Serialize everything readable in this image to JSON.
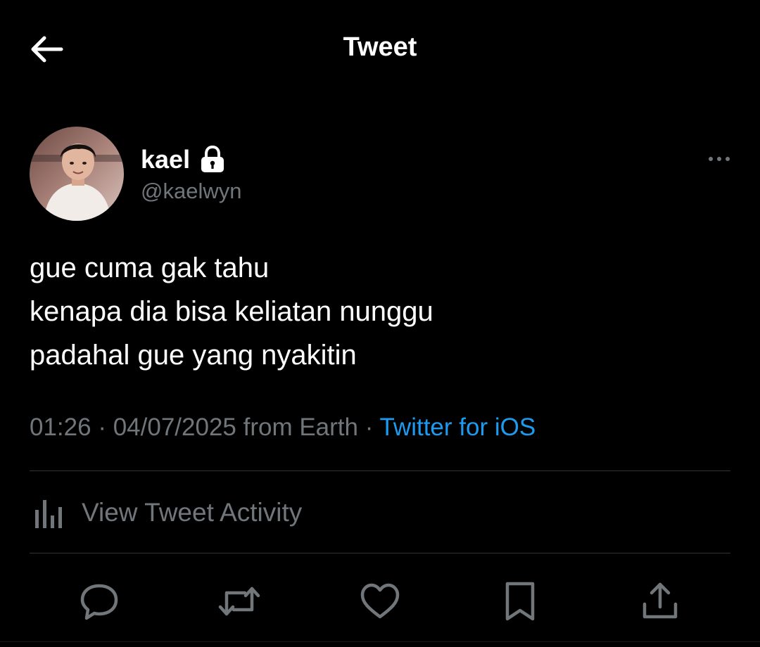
{
  "header": {
    "title": "Tweet",
    "back_icon": "arrow-left-icon"
  },
  "author": {
    "name": "kael",
    "handle": "@kaelwyn",
    "protected_icon": "lock-icon",
    "avatar": "avatar-photo",
    "more_icon": "more-horizontal-icon"
  },
  "tweet": {
    "lines": [
      "gue cuma gak tahu",
      "kenapa dia bisa keliatan nunggu",
      "padahal gue yang nyakitin"
    ],
    "time": "01:26",
    "sep1": " · ",
    "date": "04/07/2025",
    "location": " from Earth",
    "sep2": " · ",
    "source": "Twitter for iOS"
  },
  "activity": {
    "label": "View Tweet Activity",
    "icon": "analytics-bars-icon"
  },
  "actions": [
    {
      "name": "reply",
      "icon": "reply-bubble-icon"
    },
    {
      "name": "retweet",
      "icon": "retweet-icon"
    },
    {
      "name": "like",
      "icon": "heart-icon"
    },
    {
      "name": "bookmark",
      "icon": "bookmark-icon"
    },
    {
      "name": "share",
      "icon": "share-upload-icon"
    }
  ],
  "colors": {
    "background": "#000000",
    "text_primary": "#ffffff",
    "text_secondary": "#71767b",
    "link": "#1d9bf0",
    "divider": "#2f3336"
  }
}
